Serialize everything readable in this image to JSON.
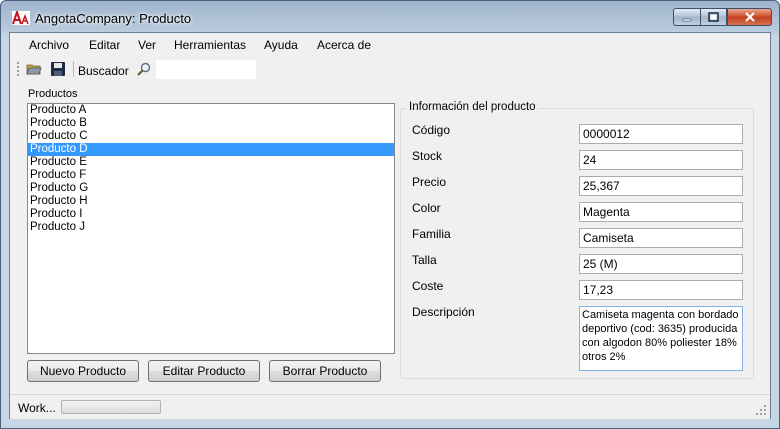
{
  "window": {
    "title": "AngotaCompany: Producto"
  },
  "menu": [
    "Archivo",
    "Editar",
    "Ver",
    "Herramientas",
    "Ayuda",
    "Acerca de"
  ],
  "toolbar": {
    "search_label": "Buscador",
    "search_value": ""
  },
  "products": {
    "label": "Productos",
    "items": [
      "Producto A",
      "Producto B",
      "Producto C",
      "Producto D",
      "Producto E",
      "Producto F",
      "Producto G",
      "Producto H",
      "Producto I",
      "Producto J"
    ],
    "selected": "Producto D"
  },
  "buttons": {
    "new": "Nuevo Producto",
    "edit": "Editar Producto",
    "delete": "Borrar Producto"
  },
  "info": {
    "title": "Información del producto",
    "fields": [
      {
        "label": "Código",
        "value": "0000012"
      },
      {
        "label": "Stock",
        "value": "24"
      },
      {
        "label": "Precio",
        "value": "25,367"
      },
      {
        "label": "Color",
        "value": "Magenta"
      },
      {
        "label": "Familia",
        "value": "Camiseta"
      },
      {
        "label": "Talla",
        "value": "25 (M)"
      },
      {
        "label": "Coste",
        "value": "17,23"
      }
    ],
    "description_label": "Descripción",
    "description_value": "Camiseta magenta con bordado deportivo (cod: 3635) producida con algodon 80% poliester 18% otros 2%"
  },
  "status": {
    "text": "Work...",
    "progress": 0.0
  },
  "colors": {
    "selection": "#3399ff",
    "close_button": "#c94a28",
    "client_bg": "#f0f0f0"
  },
  "icons": [
    "app-logo-icon",
    "open-folder-icon",
    "save-disk-icon",
    "magnifier-icon",
    "resize-grip-icon"
  ]
}
